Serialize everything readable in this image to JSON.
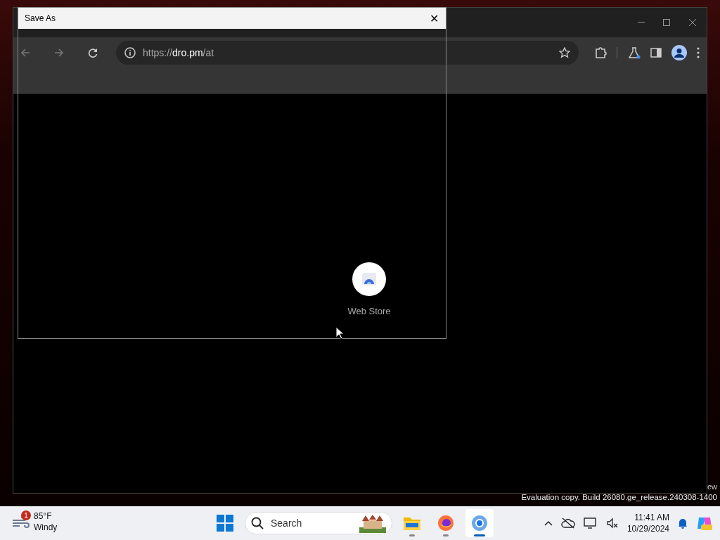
{
  "dialog": {
    "title": "Save As",
    "close": "✕"
  },
  "browser": {
    "url": "https://**dro.pm**/at",
    "shortcuts": [
      {
        "label": "Web Store"
      }
    ]
  },
  "desktop": {
    "edge_text": "ew",
    "watermark": "Evaluation copy. Build 26080.ge_release.240308-1400"
  },
  "taskbar": {
    "weather": {
      "badge": "1",
      "temperature": "85°F",
      "condition": "Windy"
    },
    "search": {
      "placeholder": "Search"
    },
    "apps": [
      {
        "kind": "files",
        "selected": false
      },
      {
        "kind": "firefox",
        "selected": false
      },
      {
        "kind": "chrome",
        "selected": true
      }
    ],
    "clock": {
      "time": "11:41 AM",
      "date": "10/29/2024"
    }
  }
}
